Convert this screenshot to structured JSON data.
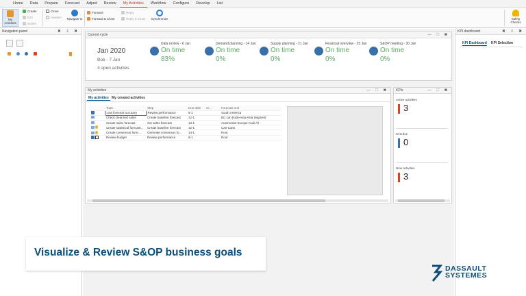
{
  "menu": [
    "Home",
    "Data",
    "Prepare",
    "Forecast",
    "Adjust",
    "Review",
    "My Activities",
    "Workflow",
    "Configure",
    "Develop",
    "List"
  ],
  "menu_active": "My Activities",
  "ribbon": {
    "my_activities": "My Activities",
    "create": "Create",
    "edit": "Edit",
    "delete": "Delete",
    "close": "Close",
    "awaken": "Awaken",
    "navigate_to": "Navigate to",
    "forward": "Forward",
    "forward_close": "Forward & Close",
    "reply": "Reply",
    "reply_close": "Reply & Close",
    "synchronize": "Synchronize",
    "safety_checks": "Safety Checks"
  },
  "navigation_panel": {
    "title": "Navigation panel"
  },
  "current_cycle": {
    "title": "Current cycle",
    "period": "Jan 2020",
    "user_dates": "Bob - 7 Jan",
    "open_activities": "3 open activities",
    "steps": [
      {
        "title": "Data review - 6 Jan",
        "status": "On time",
        "progress": "83%"
      },
      {
        "title": "Demand planning - 14 Jan",
        "status": "On time",
        "progress": "0%"
      },
      {
        "title": "Supply planning - 21 Jan",
        "status": "On time",
        "progress": "0%"
      },
      {
        "title": "Financial overview - 25 Jan",
        "status": "On time",
        "progress": "0%"
      },
      {
        "title": "S&OP meeting - 30 Jan",
        "status": "On time",
        "progress": "0%"
      }
    ]
  },
  "my_activities": {
    "title": "My activities",
    "tabs": [
      "My activities",
      "My created activities"
    ],
    "columns": [
      "Topic",
      "Step",
      "Due date",
      "Cr...",
      "Forecast unit"
    ],
    "rows": [
      [
        "Low forecast accuracy",
        "Review performance",
        "6-1",
        "",
        "South America"
      ],
      [
        "Check cleansed sales",
        "Create baseline forecast",
        "12-1",
        "",
        "BC can body-Asia-Asia Segment"
      ],
      [
        "Create sales forecast",
        "Set sales forecast",
        "13-1",
        "",
        "Automotive-Europe-Audi All"
      ],
      [
        "Create statistical forecast...",
        "Create baseline forecast",
        "12-1",
        "",
        "Can-Cans"
      ],
      [
        "Create consensus forec...",
        "Generate consensus fo...",
        "14-1",
        "",
        "Root"
      ],
      [
        "Review budget",
        "Review performance",
        "6-1",
        "",
        "Root"
      ]
    ]
  },
  "kpis": {
    "title": "KPIs",
    "tiles": [
      {
        "label": "Active activities",
        "value": "3",
        "color": "#e2401c"
      },
      {
        "label": "Overdue",
        "value": "0",
        "color": "#3b6fa8"
      },
      {
        "label": "New activities",
        "value": "3",
        "color": "#e2401c"
      }
    ]
  },
  "kpi_dashboard": {
    "title": "KPI dashboard",
    "tabs": [
      "KPI Dashboard",
      "KPI Selection"
    ]
  },
  "banner_text": "Visualize & Review S&OP business goals",
  "logo": {
    "line1": "DASSAULT",
    "line2": "SYSTEMES"
  }
}
